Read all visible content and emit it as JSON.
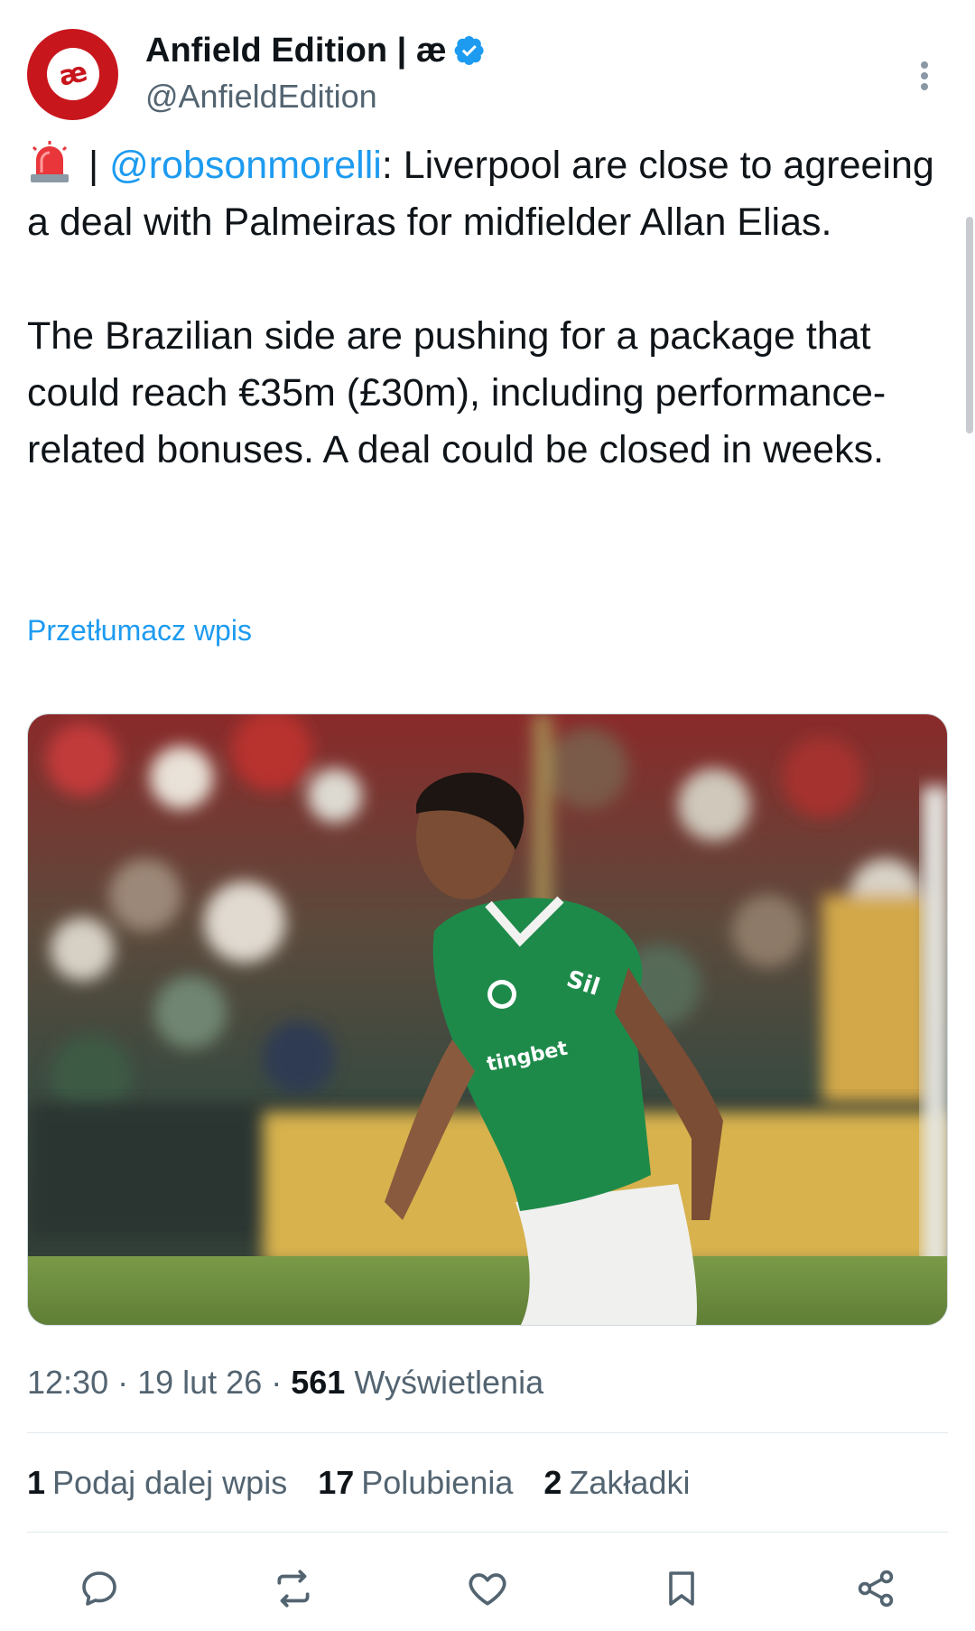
{
  "author": {
    "display_name": "Anfield Edition | æ",
    "handle": "@AnfieldEdition",
    "avatar_text": "æ",
    "brand_color": "#c8161d"
  },
  "tweet": {
    "mention": "@robsonmorelli",
    "separator": " | ",
    "paragraph1_rest": ": Liverpool are close to agreeing a deal with Palmeiras for midfielder Allan Elias.",
    "paragraph2": "The Brazilian side are pushing for a package that could reach €35m (£30m), including performance-related bonuses. A deal could be closed in weeks.",
    "translate_label": "Przetłumacz wpis"
  },
  "meta": {
    "time": "12:30",
    "date": "19 lut 26",
    "views_count": "561",
    "views_label": "Wyświetlenia"
  },
  "stats": {
    "reposts_count": "1",
    "reposts_label": "Podaj dalej wpis",
    "likes_count": "17",
    "likes_label": "Polubienia",
    "bookmarks_count": "2",
    "bookmarks_label": "Zakładki"
  },
  "colors": {
    "accent": "#1d9bf0",
    "secondary_text": "#536471",
    "primary_text": "#0f1419"
  },
  "icons": {
    "reply": "reply-icon",
    "repost": "repost-icon",
    "like": "heart-icon",
    "bookmark": "bookmark-icon",
    "share": "share-icon",
    "verified": "verified-badge-icon",
    "more": "more-icon",
    "siren": "siren-emoji-icon"
  }
}
